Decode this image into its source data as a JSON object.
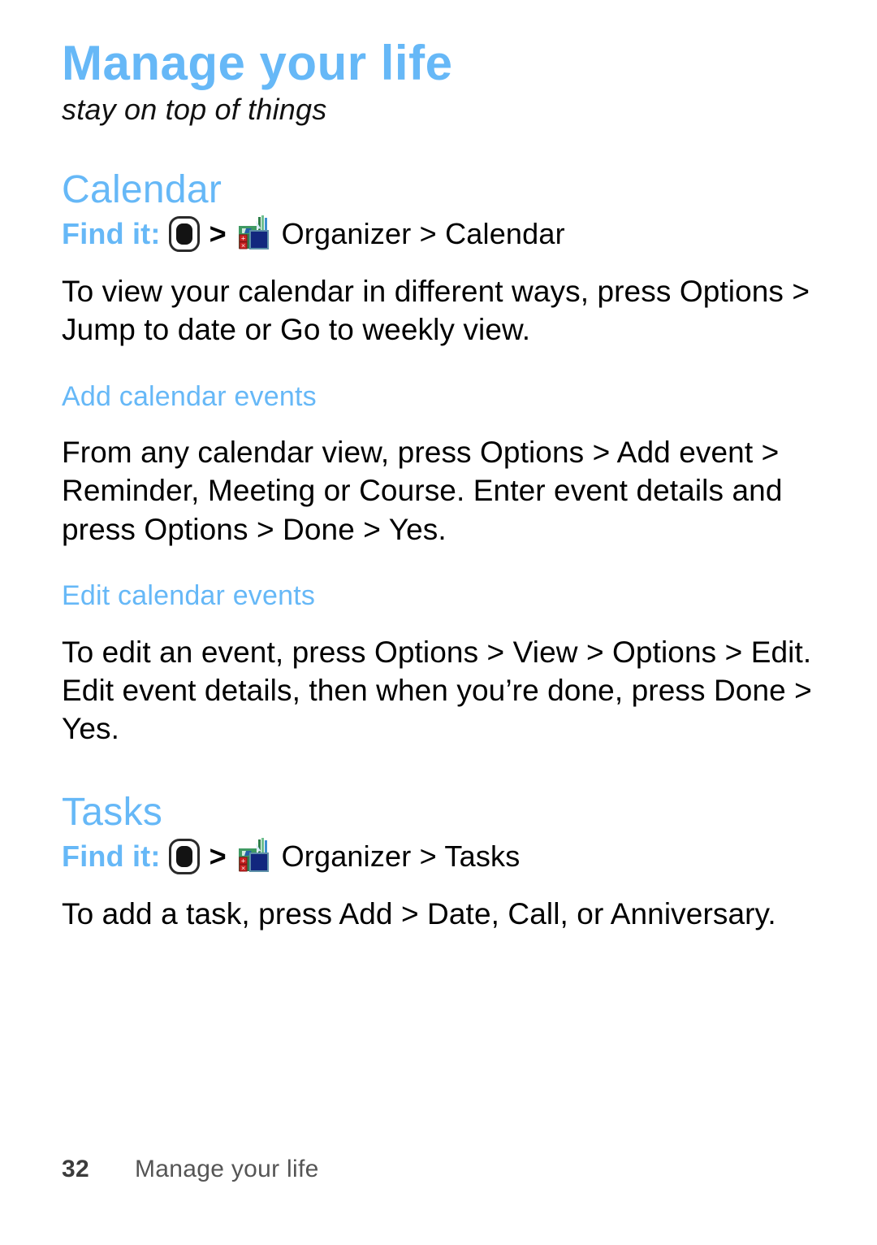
{
  "document": {
    "chapter_title": "Manage your life",
    "chapter_subtitle": "stay on top of things"
  },
  "colors": {
    "heading_blue": "#66b8f7",
    "body_black": "#000000",
    "footer_gray": "#555555"
  },
  "calendar": {
    "heading": "Calendar",
    "find_it": {
      "label": "Find it:",
      "center_key_icon": "center-key-icon",
      "separator_1": ">",
      "organizer_icon": "organizer-icon",
      "path": "Organizer > Calendar"
    },
    "intro": "To view your calendar in different ways, press Options > Jump to date or Go to weekly view.",
    "add_events": {
      "heading": "Add calendar events",
      "body": "From any calendar view, press Options > Add event > Reminder, Meeting or Course. Enter event details and press Options > Done > Yes."
    },
    "edit_events": {
      "heading": "Edit calendar events",
      "body": "To edit an event, press Options > View > Options > Edit. Edit event details, then when you’re done, press Done > Yes."
    }
  },
  "tasks": {
    "heading": "Tasks",
    "find_it": {
      "label": "Find it:",
      "center_key_icon": "center-key-icon",
      "separator_1": ">",
      "organizer_icon": "organizer-icon",
      "path": "Organizer > Tasks"
    },
    "body": "To add a task, press Add > Date, Call, or Anniversary."
  },
  "footer": {
    "page_number": "32",
    "title": "Manage your life"
  }
}
